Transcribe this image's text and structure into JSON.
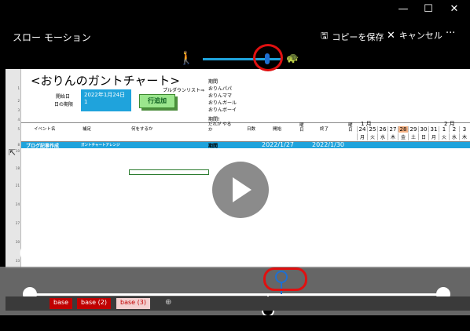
{
  "window": {
    "minimize": "—",
    "maximize": "☐",
    "close": "✕"
  },
  "app": {
    "title": "スロー モーション",
    "save_copy": "コピーを保存",
    "cancel": "キャンセル",
    "more": "···"
  },
  "speed_slider": {
    "level": 0.8
  },
  "sheet": {
    "title": "<おりんのガントチャート>",
    "start_date_label": "開始日",
    "today_label": "日の期限",
    "start_date_value": "2022年1月24日",
    "today_value": "1",
    "pulldown_label": "プルダウンリスト⇒",
    "pulldown_items": [
      "期間",
      "おりんパパ",
      "おりんママ",
      "おりんガール",
      "おりんボーイ",
      "期間!"
    ],
    "add_row_button": "行追加",
    "headers": {
      "event": "イベント名",
      "detail": "補足",
      "what": "何をするか",
      "who": "だれが やるか",
      "days": "日数",
      "start": "開始",
      "weekday1": "曜日",
      "end": "終了",
      "weekday2": "曜日"
    },
    "row": {
      "event": "ブログ記事作成",
      "detail": "ガントチャートアレンジ",
      "who": "期間",
      "start": "2022/1/27",
      "end": "2022/1/30"
    },
    "calendar": {
      "month1": "1 月",
      "month2": "2 月",
      "days": [
        "24",
        "25",
        "26",
        "27",
        "28",
        "29",
        "30",
        "31",
        "1",
        "2",
        "3"
      ],
      "weekdays": [
        "月",
        "火",
        "水",
        "木",
        "金",
        "土",
        "日",
        "月",
        "火",
        "水",
        "木"
      ]
    }
  },
  "timeline": {
    "position": 0.57
  },
  "tabs": [
    "base",
    "base (2)",
    "base (3)"
  ],
  "add_tab": "⊕",
  "colors": {
    "accent": "#1fa3dc",
    "annotation": "#e01010",
    "tab": "#c00000"
  }
}
